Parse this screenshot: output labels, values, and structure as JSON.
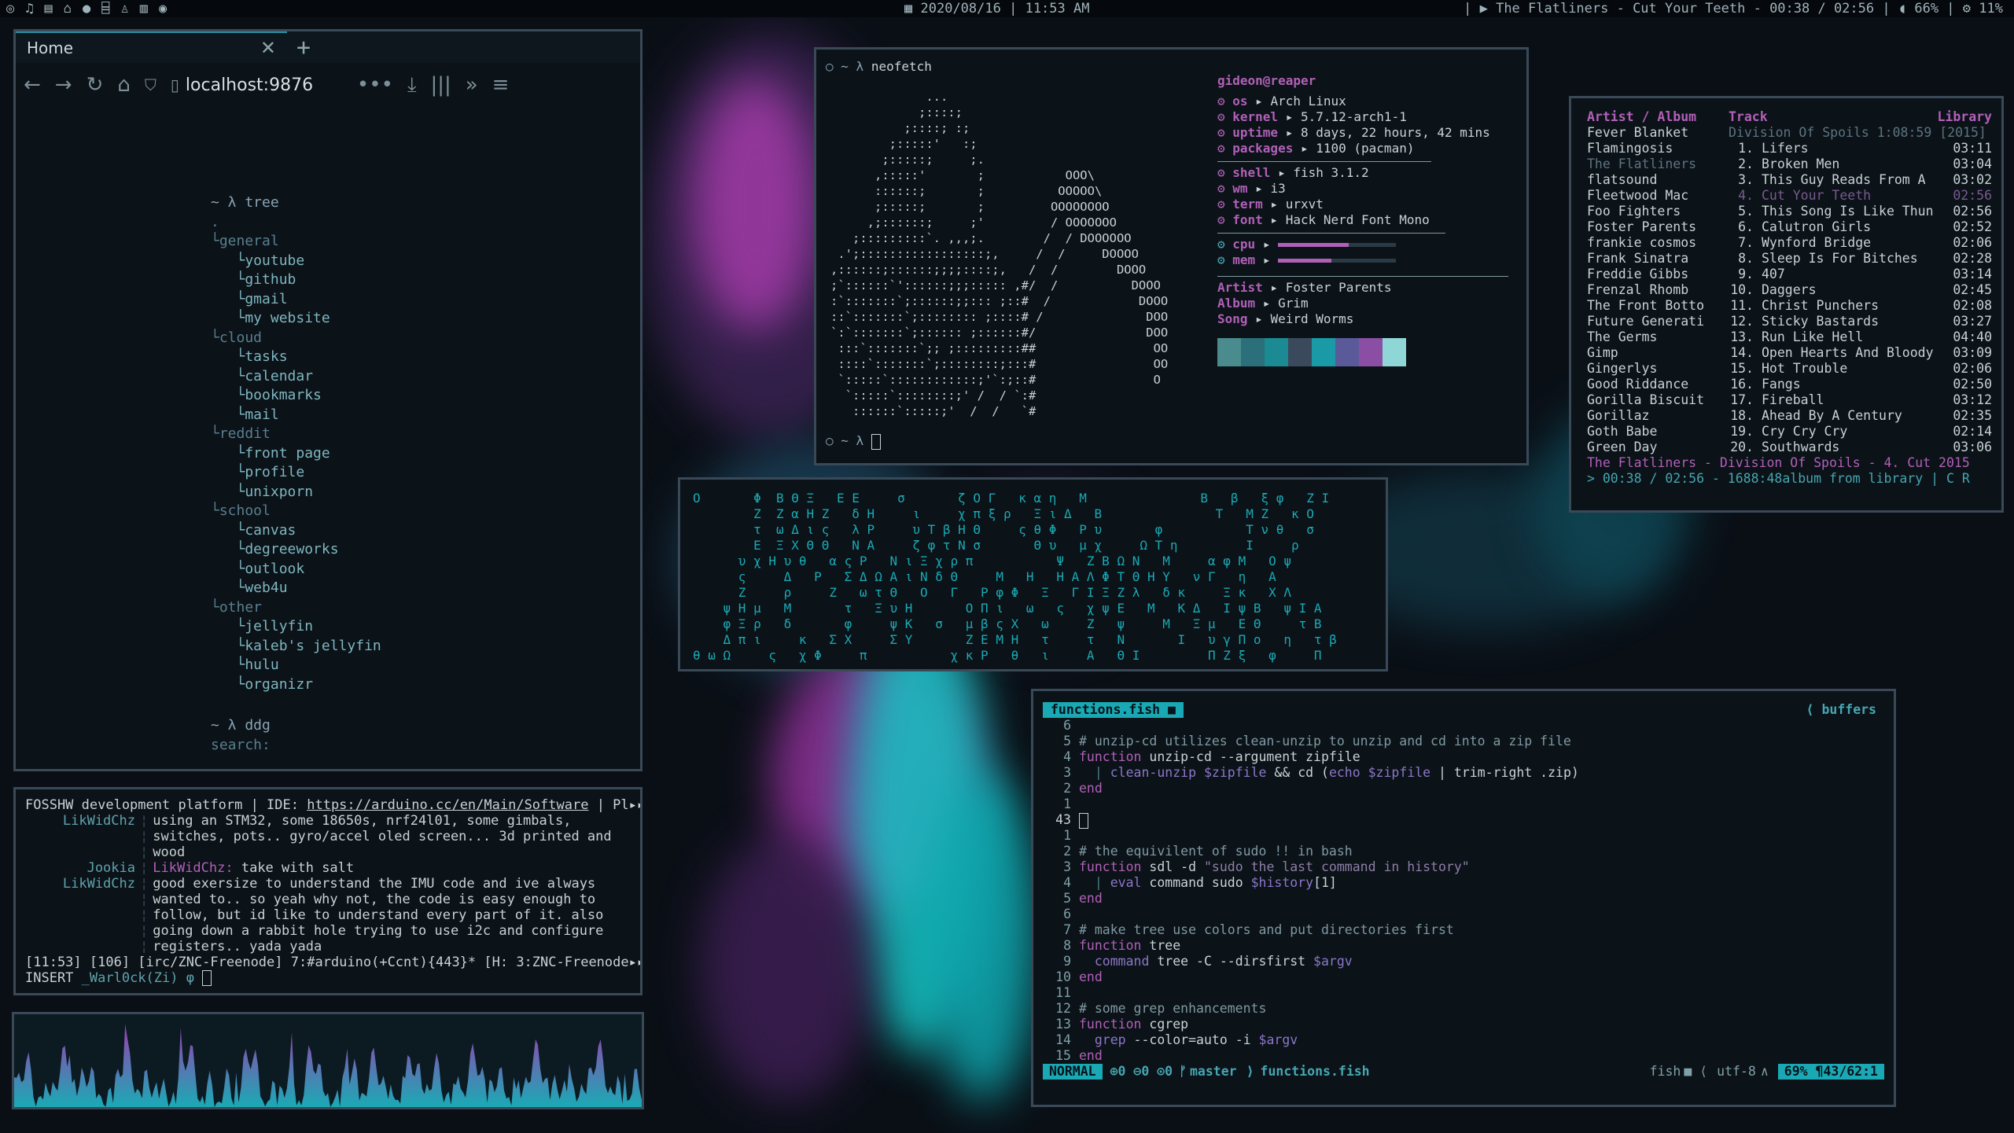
{
  "topbar": {
    "date": "2020/08/16",
    "time": "11:53 AM",
    "now_playing": "The Flatliners - Cut Your Teeth - 00:38 / 02:56",
    "volume": "66%",
    "cpu": "11%",
    "left_icons": [
      "circle-icon",
      "music-icon",
      "film-icon",
      "home-icon",
      "globe-icon",
      "bank-icon",
      "flask-icon",
      "chart-icon",
      "chat-icon"
    ]
  },
  "browser": {
    "tab_title": "Home",
    "url": "localhost:9876",
    "tree_prompt": "~ λ tree",
    "categories": [
      {
        "name": "general",
        "items": [
          "youtube",
          "github",
          "gmail",
          "my website"
        ]
      },
      {
        "name": "cloud",
        "items": [
          "tasks",
          "calendar",
          "bookmarks",
          "mail"
        ]
      },
      {
        "name": "reddit",
        "items": [
          "front page",
          "profile",
          "unixporn"
        ]
      },
      {
        "name": "school",
        "items": [
          "canvas",
          "degreeworks",
          "outlook",
          "web4u"
        ]
      },
      {
        "name": "other",
        "items": [
          "jellyfin",
          "kaleb's jellyfin",
          "hulu",
          "organizr"
        ]
      }
    ],
    "ddg_prompt": "~ λ ddg",
    "search_label": "search:"
  },
  "neofetch": {
    "prompt": "○ ~ λ",
    "command": "neofetch",
    "user": "gideon@reaper",
    "info": [
      {
        "key": "os",
        "value": "Arch Linux"
      },
      {
        "key": "kernel",
        "value": "5.7.12-arch1-1"
      },
      {
        "key": "uptime",
        "value": "8 days, 22 hours, 42 mins"
      },
      {
        "key": "packages",
        "value": "1100 (pacman)"
      }
    ],
    "info2": [
      {
        "key": "shell",
        "value": "fish 3.1.2"
      },
      {
        "key": "wm",
        "value": "i3"
      },
      {
        "key": "term",
        "value": "urxvt"
      },
      {
        "key": "font",
        "value": "Hack Nerd Font Mono"
      }
    ],
    "cpu_label": "cpu",
    "mem_label": "mem",
    "cpu_level": 0.6,
    "mem_level": 0.45,
    "artist_label": "Artist",
    "artist": "Foster Parents",
    "album_label": "Album",
    "album": "Grim",
    "song_label": "Song",
    "song": "Weird Worms",
    "palette": [
      "#4a8b8e",
      "#2a6f79",
      "#1b8a92",
      "#3a4a5c",
      "#1a99a6",
      "#5a5a9a",
      "#8a4fa5",
      "#8fd6d6"
    ],
    "bottom_prompt": "○ ~ λ"
  },
  "music": {
    "headers": {
      "artist": "Artist / Album",
      "track": "Track",
      "library": "Library"
    },
    "artists": [
      "Fever Blanket",
      "Flamingosis",
      "The Flatliners",
      "flatsound",
      "Fleetwood Mac",
      "Foo Fighters",
      "Foster Parents",
      "frankie cosmos",
      "Frank Sinatra",
      "Freddie Gibbs",
      "Frenzal Rhomb",
      "The Front Botto",
      "Future Generati",
      "The Germs",
      "Gimp",
      "Gingerlys",
      "Good Riddance",
      "Gorilla Biscuit",
      "Gorillaz",
      "Goth Babe",
      "Green Day"
    ],
    "album_line": "Division Of Spoils 1:08:59 [2015]",
    "tracks": [
      {
        "n": "1.",
        "title": "Lifers",
        "time": "03:11"
      },
      {
        "n": "2.",
        "title": "Broken Men",
        "time": "03:04"
      },
      {
        "n": "3.",
        "title": "This Guy Reads From A",
        "time": "03:02"
      },
      {
        "n": "4.",
        "title": "Cut Your Teeth",
        "time": "02:56"
      },
      {
        "n": "5.",
        "title": "This Song Is Like Thun",
        "time": "02:56"
      },
      {
        "n": "6.",
        "title": "Calutron Girls",
        "time": "02:52"
      },
      {
        "n": "7.",
        "title": "Wynford Bridge",
        "time": "02:06"
      },
      {
        "n": "8.",
        "title": "Sleep Is For Bitches",
        "time": "02:28"
      },
      {
        "n": "9.",
        "title": "407",
        "time": "03:14"
      },
      {
        "n": "10.",
        "title": "Daggers",
        "time": "02:45"
      },
      {
        "n": "11.",
        "title": "Christ Punchers",
        "time": "02:08"
      },
      {
        "n": "12.",
        "title": "Sticky Bastards",
        "time": "03:27"
      },
      {
        "n": "13.",
        "title": "Run Like Hell",
        "time": "04:40"
      },
      {
        "n": "14.",
        "title": "Open Hearts And Bloody",
        "time": "03:09"
      },
      {
        "n": "15.",
        "title": "Hot Trouble",
        "time": "02:06"
      },
      {
        "n": "16.",
        "title": "Fangs",
        "time": "02:50"
      },
      {
        "n": "17.",
        "title": "Fireball",
        "time": "03:12"
      },
      {
        "n": "18.",
        "title": "Ahead By A Century",
        "time": "02:35"
      },
      {
        "n": "19.",
        "title": "Cry Cry Cry",
        "time": "02:14"
      },
      {
        "n": "20.",
        "title": "Southwards",
        "time": "03:06"
      }
    ],
    "status_line": "The Flatliners - Division Of Spoils -  4. Cut 2015",
    "progress_line": "> 00:38 / 02:56 - 1688:48album from library | C R"
  },
  "irc": {
    "topic": "FOSSHW development platform | IDE: ",
    "topic_link": "https://arduino.cc/en/Main/Software",
    "topic_rest": " | Pl▸▸",
    "lines": [
      {
        "nick": "LikWidChz",
        "text": "using an STM32, some 18650s, nrf24l01, some gimbals,"
      },
      {
        "nick": "",
        "text": "switches, pots.. gyro/accel oled screen... 3d printed and"
      },
      {
        "nick": "",
        "text": "wood"
      },
      {
        "nick": "Jookia",
        "text": "LikWidChz: take with salt"
      },
      {
        "nick": "LikWidChz",
        "text": "good exersize to understand the IMU code and ive always"
      },
      {
        "nick": "",
        "text": "wanted to.. so yeah why not, the code is easy enough to"
      },
      {
        "nick": "",
        "text": "follow, but id like to understand every part of it. also"
      },
      {
        "nick": "",
        "text": "going down a rabbit hole trying to use i2c and configure"
      },
      {
        "nick": "",
        "text": "registers.. yada yada"
      }
    ],
    "status": "[11:53] [106] [irc/ZNC-Freenode] 7:#arduino(+Ccnt){443}* [H: 3:ZNC-Freenode▸▸",
    "input_mode": "INSERT",
    "input_nick": "_Warl0ck(Zi) φ"
  },
  "editor": {
    "filename": "functions.fish",
    "buffers_label": "buffers",
    "mode": "NORMAL",
    "git_stats": "⊕0 ⊖0 ⊙0",
    "branch": "master",
    "status_file": "functions.fish",
    "filetype": "fish",
    "encoding": "utf-8",
    "position": "69% ¶43/62:1",
    "lines": [
      {
        "n": "6",
        "html": ""
      },
      {
        "n": "5",
        "html": "<span class='cm'># unzip-cd utilizes clean-unzip to unzip and cd into a zip file</span>"
      },
      {
        "n": "4",
        "html": "<span class='kw'>function</span> unzip-cd --argument zipfile"
      },
      {
        "n": "3",
        "html": "  <span class='dim'>|</span> <span class='vr'>clean-unzip</span> <span class='vr'>$zipfile</span> &amp;&amp; cd (<span class='vr'>echo</span> <span class='vr'>$zipfile</span> | trim-right .zip)"
      },
      {
        "n": "2",
        "html": "<span class='kw'>end</span>"
      },
      {
        "n": "1",
        "html": ""
      },
      {
        "n": "43",
        "html": "<span style='display:inline-block;width:10px;height:18px;border:1px solid #c8d3d5;vertical-align:middle'></span>"
      },
      {
        "n": "1",
        "html": ""
      },
      {
        "n": "2",
        "html": "<span class='cm'># the equivilent of sudo !! in bash</span>"
      },
      {
        "n": "3",
        "html": "<span class='kw'>function</span> sdl -d <span class='str'>\"sudo the last command in history\"</span>"
      },
      {
        "n": "4",
        "html": "  <span class='dim'>|</span> <span class='vr'>eval</span> command sudo <span class='vr'>$history</span>[1]"
      },
      {
        "n": "5",
        "html": "<span class='kw'>end</span>"
      },
      {
        "n": "6",
        "html": ""
      },
      {
        "n": "7",
        "html": "<span class='cm'># make tree use colors and put directories first</span>"
      },
      {
        "n": "8",
        "html": "<span class='kw'>function</span> tree"
      },
      {
        "n": "9",
        "html": "  <span class='vr'>command</span> tree -C --dirsfirst <span class='vr'>$argv</span>"
      },
      {
        "n": "10",
        "html": "<span class='kw'>end</span>"
      },
      {
        "n": "11",
        "html": ""
      },
      {
        "n": "12",
        "html": "<span class='cm'># some grep enhancements</span>"
      },
      {
        "n": "13",
        "html": "<span class='kw'>function</span> cgrep"
      },
      {
        "n": "14",
        "html": "  <span class='vr'>grep</span> --color=auto -i <span class='vr'>$argv</span>"
      },
      {
        "n": "15",
        "html": "<span class='kw'>end</span>"
      }
    ]
  },
  "matrix": {
    "rows": [
      "Ο       Φ  Β Θ Ξ   Ε Ε     σ       ζ Ο Γ   κ α η   Μ               Β   β   ξ φ   Ζ Ι",
      "        Ζ  Ζ α Η Ζ   δ Η     ι     χ π ξ ρ   Ξ ι Δ   Β               Τ   Μ Ζ   κ Ο",
      "        τ  ω Δ ι ς   λ Ρ     υ Τ β Η Θ     ς θ Φ   Ρ υ       φ           Τ ν θ   σ",
      "        Ε  Ξ Χ Θ Θ   Ν Α     ζ φ τ Ν σ       Θ υ   μ χ     Ω Τ η         Ι     ρ",
      "      υ χ Η υ θ   α ς Ρ   Ν ι Ξ χ ρ π           Ψ   Ζ Β Ω Ν   Μ     α φ Μ   Ο ψ",
      "      ς     Δ   Ρ   Σ Δ Ω Α ι Ν δ Θ     Μ   Η   Η Α Λ Φ Τ Θ Η Υ   ν Γ   η   Α",
      "      Ζ     ρ     Ζ   ω τ Θ   Ο   Γ   Ρ φ Φ   Ξ   Γ Ι Ξ Ζ λ   δ κ     Ξ κ   Χ Λ",
      "    ψ Η μ   Μ       τ   Ξ υ Η       Ο Π ι   ω   ς   χ ψ Ε   Μ   Κ Δ   Ι ψ Β   ψ Ι Α",
      "    φ Ξ ρ   δ       φ     ψ Κ   σ   μ β ς Χ   ω     Ζ   ψ     Μ   Ξ μ   Ε Θ     τ Β",
      "    Δ π ι     κ   Σ Χ     Σ Υ       Ζ Ε Μ Η   τ     τ   Ν       Ι   υ γ Π ο   η   τ β",
      "θ ω Ω     ς   χ Φ     π           χ κ Ρ   θ   ι     Α   Θ Ι         Π Ζ ξ   φ     Π"
    ]
  }
}
